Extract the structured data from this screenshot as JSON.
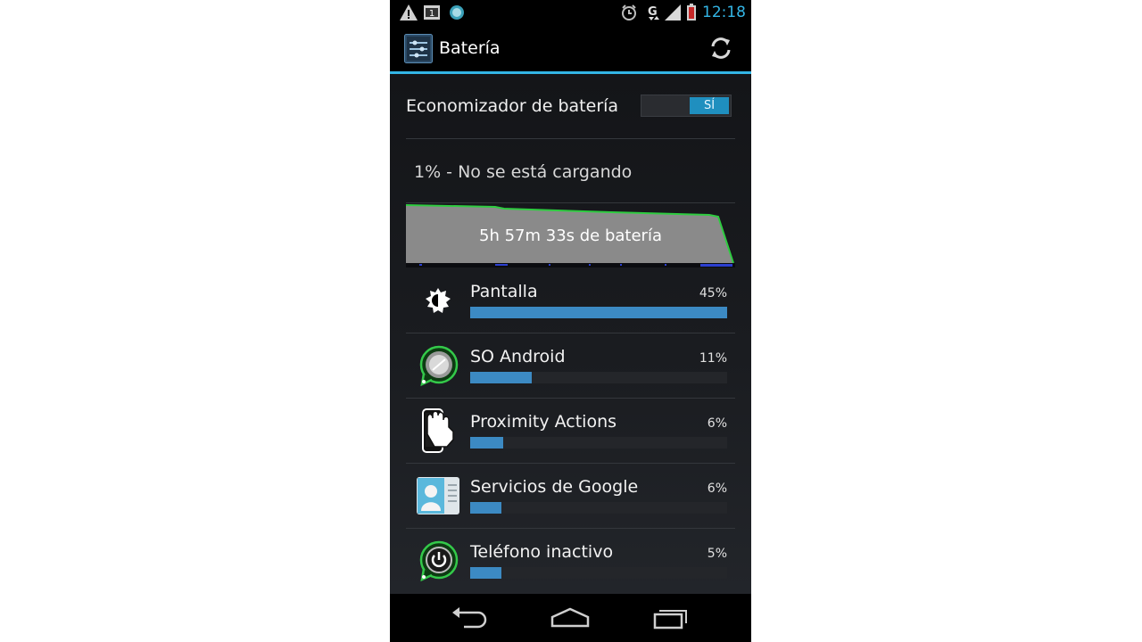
{
  "status_bar": {
    "time": "12:18",
    "icons": [
      "warning-icon",
      "sim-icon",
      "app-notification-icon",
      "alarm-icon",
      "data-g-icon",
      "signal-icon",
      "battery-low-icon"
    ]
  },
  "action_bar": {
    "title": "Batería",
    "icons": [
      "settings-app-icon",
      "refresh-icon"
    ]
  },
  "saver": {
    "label": "Economizador de batería",
    "toggle_on_label": "SÍ",
    "enabled": true
  },
  "battery": {
    "status": "1% - No se está cargando",
    "graph_label": "5h 57m 33s de batería",
    "graph_line_color": "#2ecc40"
  },
  "usage": [
    {
      "name": "Pantalla",
      "percent_label": "45%",
      "fill": 1.0,
      "icon": "brightness-icon"
    },
    {
      "name": "SO Android",
      "percent_label": "11%",
      "fill": 0.24,
      "icon": "android-os-icon"
    },
    {
      "name": "Proximity Actions",
      "percent_label": "6%",
      "fill": 0.13,
      "icon": "hand-phone-icon"
    },
    {
      "name": "Servicios de Google",
      "percent_label": "6%",
      "fill": 0.12,
      "icon": "google-services-icon"
    },
    {
      "name": "Teléfono inactivo",
      "percent_label": "5%",
      "fill": 0.12,
      "icon": "power-icon"
    }
  ],
  "nav_bar": {
    "icons": [
      "back-icon",
      "home-icon",
      "recents-icon"
    ]
  },
  "colors": {
    "accent": "#33b5e5",
    "bar_fill": "#3c8ac3",
    "toggle_on": "#1f8fbf"
  }
}
